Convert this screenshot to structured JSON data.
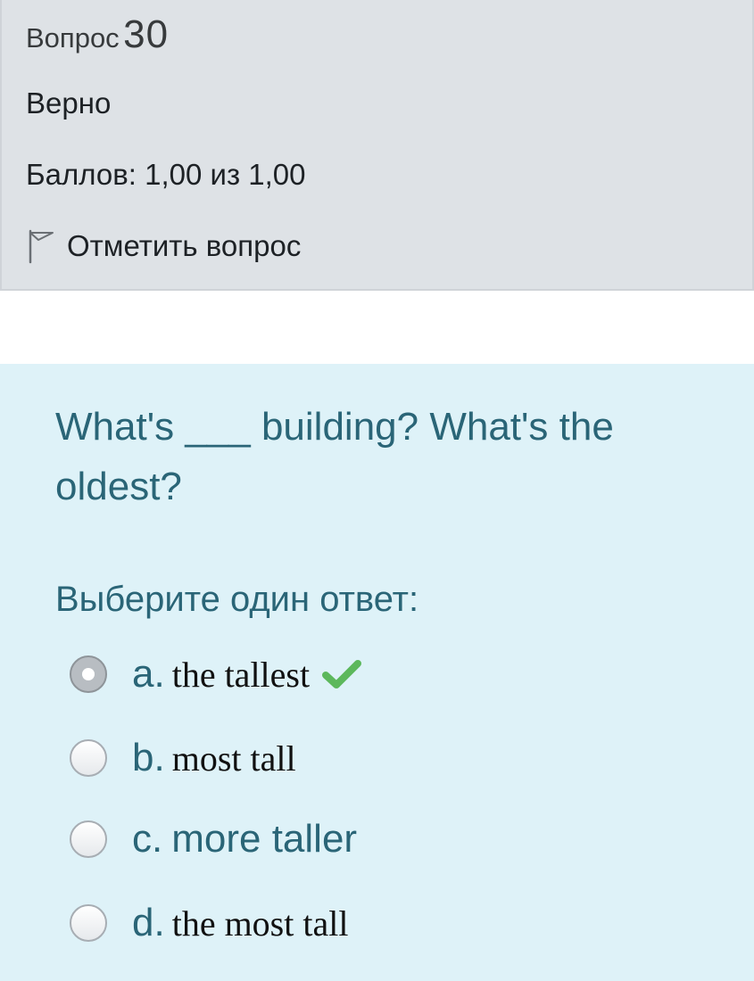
{
  "info": {
    "question_prefix": "Вопрос",
    "question_number": "30",
    "state": "Верно",
    "grade": "Баллов: 1,00 из 1,00",
    "flag_label": "Отметить вопрос",
    "flag_icon": "flag-outline-icon"
  },
  "question": {
    "text": "What's ___ building? What's the oldest?",
    "prompt": "Выберите один ответ:",
    "answers": [
      {
        "letter": "a.",
        "text": "the tallest",
        "selected": true,
        "correct_mark": true
      },
      {
        "letter": "b.",
        "text": "most tall",
        "selected": false,
        "correct_mark": false
      },
      {
        "letter": "c.",
        "text": "more taller",
        "selected": false,
        "correct_mark": false
      },
      {
        "letter": "d.",
        "text": "the most tall",
        "selected": false,
        "correct_mark": false
      }
    ],
    "check_icon": "checkmark-icon"
  },
  "colors": {
    "info_background": "#dee2e6",
    "content_background": "#def2f8",
    "accent_text": "#2a6577",
    "correct_green": "#5cb85c"
  }
}
